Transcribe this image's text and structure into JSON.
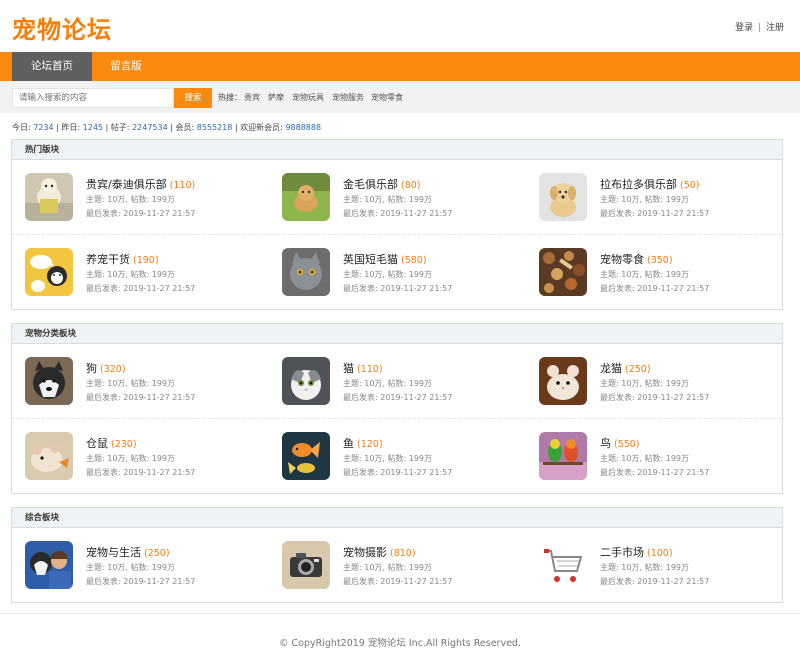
{
  "header": {
    "logo": "宠物论坛",
    "login": "登录",
    "separator": "|",
    "register": "注册"
  },
  "nav": {
    "items": [
      {
        "label": "论坛首页",
        "active": true
      },
      {
        "label": "留言版",
        "active": false
      }
    ]
  },
  "search": {
    "placeholder": "请输入搜索的内容",
    "button": "搜索",
    "hot_label": "热搜：",
    "hot_items": [
      "贵宾",
      "萨摩",
      "宠物玩具",
      "宠物服务",
      "宠物零食"
    ]
  },
  "stats": {
    "today_label": "今日:",
    "today": "7234",
    "yesterday_label": "昨日:",
    "yesterday": "1245",
    "posts_label": "帖子:",
    "posts": "2247534",
    "members_label": "会员:",
    "members": "8555218",
    "newest_label": "欢迎新会员:",
    "newest": "9888888"
  },
  "sections": [
    {
      "title": "热门版块",
      "forums": [
        {
          "name": "贵宾/泰迪俱乐部",
          "count": "(110)",
          "meta": "主题: 10万, 帖数: 199万",
          "last": "最后发表: 2019-11-27 21:57",
          "icon": "poodle-photo"
        },
        {
          "name": "金毛俱乐部",
          "count": "(80)",
          "meta": "主题: 10万, 帖数: 199万",
          "last": "最后发表: 2019-11-27 21:57",
          "icon": "golden-retriever-photo"
        },
        {
          "name": "拉布拉多俱乐部",
          "count": "(50)",
          "meta": "主题: 10万, 帖数: 199万",
          "last": "最后发表: 2019-11-27 21:57",
          "icon": "labrador-photo"
        },
        {
          "name": "养宠干货",
          "count": "(190)",
          "meta": "主题: 10万, 帖数: 199万",
          "last": "最后发表: 2019-11-27 21:57",
          "icon": "cartoon-cat-dog-image"
        },
        {
          "name": "英国短毛猫",
          "count": "(580)",
          "meta": "主题: 10万, 帖数: 199万",
          "last": "最后发表: 2019-11-27 21:57",
          "icon": "british-shorthair-photo"
        },
        {
          "name": "宠物零食",
          "count": "(350)",
          "meta": "主题: 10万, 帖数: 199万",
          "last": "最后发表: 2019-11-27 21:57",
          "icon": "pet-snacks-photo"
        }
      ]
    },
    {
      "title": "宠物分类板块",
      "forums": [
        {
          "name": "狗",
          "count": "(320)",
          "meta": "主题: 10万, 帖数: 199万",
          "last": "最后发表: 2019-11-27 21:57",
          "icon": "husky-photo"
        },
        {
          "name": "猫",
          "count": "(110)",
          "meta": "主题: 10万, 帖数: 199万",
          "last": "最后发表: 2019-11-27 21:57",
          "icon": "cat-photo"
        },
        {
          "name": "龙猫",
          "count": "(250)",
          "meta": "主题: 10万, 帖数: 199万",
          "last": "最后发表: 2019-11-27 21:57",
          "icon": "chinchilla-photo"
        },
        {
          "name": "仓鼠",
          "count": "(230)",
          "meta": "主题: 10万, 帖数: 199万",
          "last": "最后发表: 2019-11-27 21:57",
          "icon": "hamster-photo"
        },
        {
          "name": "鱼",
          "count": "(120)",
          "meta": "主题: 10万, 帖数: 199万",
          "last": "最后发表: 2019-11-27 21:57",
          "icon": "goldfish-photo"
        },
        {
          "name": "鸟",
          "count": "(550)",
          "meta": "主题: 10万, 帖数: 199万",
          "last": "最后发表: 2019-11-27 21:57",
          "icon": "parrots-photo"
        }
      ]
    },
    {
      "title": "综合板块",
      "forums": [
        {
          "name": "宠物与生活",
          "count": "(250)",
          "meta": "主题: 10万, 帖数: 199万",
          "last": "最后发表: 2019-11-27 21:57",
          "icon": "dog-and-man-photo"
        },
        {
          "name": "宠物摄影",
          "count": "(810)",
          "meta": "主题: 10万, 帖数: 199万",
          "last": "最后发表: 2019-11-27 21:57",
          "icon": "camera-photo"
        },
        {
          "name": "二手市场",
          "count": "(100)",
          "meta": "主题: 10万, 帖数: 199万",
          "last": "最后发表: 2019-11-27 21:57",
          "icon": "shopping-cart-photo"
        }
      ]
    }
  ],
  "footer": {
    "copyright": "© CopyRight2019 宠物论坛 Inc.All Rights Reserved."
  }
}
